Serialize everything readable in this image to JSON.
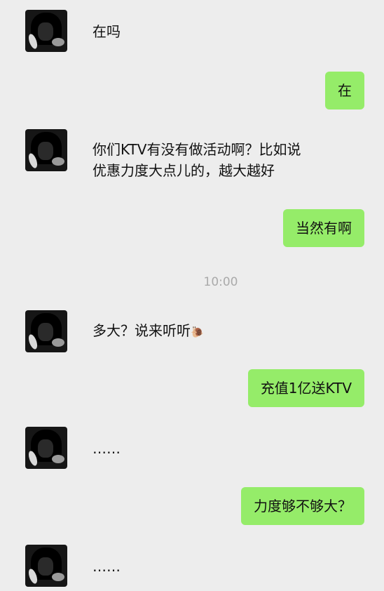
{
  "messages": [
    {
      "side": "left",
      "text": "在吗"
    },
    {
      "side": "right",
      "text": "在"
    },
    {
      "side": "left",
      "line1": "你们KTV有没有做活动啊？比如说",
      "line2": "优惠力度大点儿的，越大越好"
    },
    {
      "side": "right",
      "text": "当然有啊"
    },
    {
      "side": "left",
      "text": "多大？说来听听",
      "emoji": "🐌"
    },
    {
      "side": "right",
      "text": "充值1亿送KTV"
    },
    {
      "side": "left",
      "text": "……"
    },
    {
      "side": "right",
      "text": "力度够不够大？"
    },
    {
      "side": "left",
      "text": "……"
    }
  ],
  "timestamp": "10:00"
}
